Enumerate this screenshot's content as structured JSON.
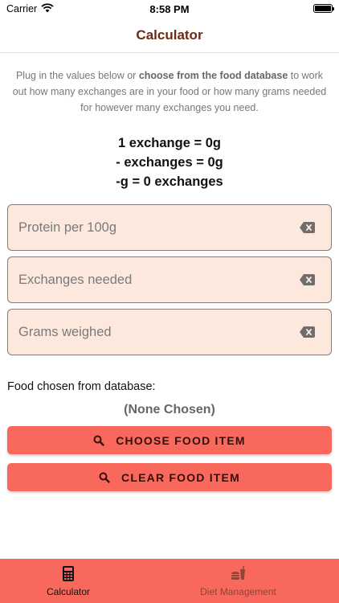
{
  "status_bar": {
    "carrier": "Carrier",
    "time": "8:58 PM"
  },
  "nav": {
    "title": "Calculator"
  },
  "intro": {
    "before": "Plug in the values below or ",
    "bold": "choose from the food database",
    "after": " to work out how many exchanges are in your food or how many grams needed for however many exchanges you need."
  },
  "results": {
    "line1": "1 exchange = 0g",
    "line2": "- exchanges = 0g",
    "line3": "-g = 0 exchanges"
  },
  "fields": {
    "protein": {
      "placeholder": "Protein per 100g",
      "value": ""
    },
    "exchanges": {
      "placeholder": "Exchanges needed",
      "value": ""
    },
    "grams": {
      "placeholder": "Grams weighed",
      "value": ""
    }
  },
  "database": {
    "label": "Food chosen from database:",
    "chosen": "(None Chosen)"
  },
  "buttons": {
    "choose": "CHOOSE FOOD ITEM",
    "clear": "CLEAR FOOD ITEM"
  },
  "tabs": [
    {
      "label": "Calculator",
      "icon": "calculator-icon",
      "active": true
    },
    {
      "label": "Diet Management",
      "icon": "food-drink-icon",
      "active": false
    }
  ],
  "colors": {
    "accent": "#f8685c",
    "title": "#6b2a18",
    "field_bg": "#fde8de",
    "inactive_tab": "#8e4438"
  }
}
